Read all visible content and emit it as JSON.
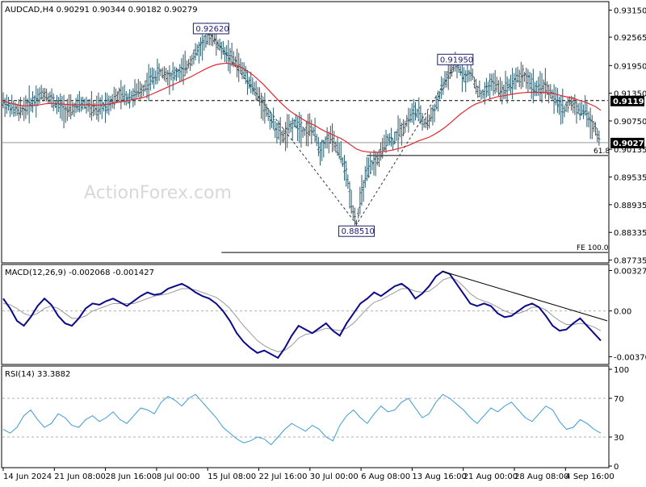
{
  "watermark": "ActionForex.com",
  "chart_data": [
    {
      "type": "candlestick",
      "header": "AUDCAD,H4  0.90291 0.90344 0.90182 0.90279",
      "symbol": "AUDCAD",
      "timeframe": "H4",
      "ohlc_last": {
        "open": 0.90291,
        "high": 0.90344,
        "low": 0.90182,
        "close": 0.90279
      },
      "ylim": [
        0.8771,
        0.933
      ],
      "y_ticks": [
        "0.93150",
        "0.92565",
        "0.91950",
        "0.91350",
        "0.90750",
        "0.90135",
        "0.89535",
        "0.88935",
        "0.88335",
        "0.87735"
      ],
      "x_ticks": [
        "14 Jun 2024",
        "21 Jun 08:00",
        "28 Jun 16:00",
        "8 Jul 00:00",
        "15 Jul 08:00",
        "22 Jul 16:00",
        "30 Jul 00:00",
        "6 Aug 08:00",
        "13 Aug 16:00",
        "21 Aug 00:00",
        "28 Aug 08:00",
        "4 Sep 16:00"
      ],
      "price_path": [
        0.9115,
        0.9108,
        0.91,
        0.9095,
        0.9102,
        0.911,
        0.912,
        0.913,
        0.9135,
        0.9125,
        0.9112,
        0.9105,
        0.91,
        0.9098,
        0.9105,
        0.9112,
        0.911,
        0.9102,
        0.9098,
        0.9105,
        0.9112,
        0.912,
        0.9128,
        0.913,
        0.9125,
        0.913,
        0.9138,
        0.9145,
        0.916,
        0.917,
        0.918,
        0.9178,
        0.9172,
        0.9175,
        0.918,
        0.9188,
        0.9205,
        0.922,
        0.9235,
        0.925,
        0.9262,
        0.9245,
        0.923,
        0.922,
        0.921,
        0.92,
        0.9185,
        0.917,
        0.915,
        0.913,
        0.911,
        0.909,
        0.907,
        0.905,
        0.904,
        0.9058,
        0.907,
        0.9065,
        0.9052,
        0.906,
        0.9045,
        0.901,
        0.903,
        0.904,
        0.902,
        0.9,
        0.896,
        0.89,
        0.8851,
        0.892,
        0.896,
        0.898,
        0.899,
        0.901,
        0.904,
        0.903,
        0.905,
        0.906,
        0.908,
        0.9095,
        0.909,
        0.907,
        0.9075,
        0.91,
        0.913,
        0.916,
        0.918,
        0.9195,
        0.9185,
        0.917,
        0.918,
        0.915,
        0.913,
        0.914,
        0.916,
        0.915,
        0.914,
        0.915,
        0.916,
        0.917,
        0.9175,
        0.9165,
        0.915,
        0.914,
        0.9155,
        0.914,
        0.9125,
        0.911,
        0.91,
        0.9115,
        0.911,
        0.9095,
        0.91,
        0.907,
        0.906,
        0.9028
      ],
      "sma_path": [
        0.9118,
        0.9115,
        0.9112,
        0.9109,
        0.9108,
        0.9108,
        0.9109,
        0.911,
        0.9112,
        0.9113,
        0.9113,
        0.9112,
        0.9111,
        0.911,
        0.911,
        0.911,
        0.911,
        0.911,
        0.9109,
        0.911,
        0.9111,
        0.9113,
        0.9115,
        0.9117,
        0.9119,
        0.9121,
        0.9123,
        0.9126,
        0.913,
        0.9135,
        0.914,
        0.9145,
        0.915,
        0.9155,
        0.916,
        0.9165,
        0.917,
        0.9176,
        0.9182,
        0.9188,
        0.9193,
        0.9197,
        0.9199,
        0.92,
        0.9198,
        0.9195,
        0.919,
        0.9183,
        0.9175,
        0.9165,
        0.9155,
        0.9143,
        0.9131,
        0.9119,
        0.9108,
        0.9098,
        0.909,
        0.9083,
        0.9076,
        0.907,
        0.9065,
        0.9058,
        0.9052,
        0.9047,
        0.9042,
        0.9037,
        0.903,
        0.9022,
        0.9014,
        0.901,
        0.9008,
        0.9007,
        0.9007,
        0.9008,
        0.901,
        0.9012,
        0.9015,
        0.9018,
        0.9022,
        0.9027,
        0.9032,
        0.9036,
        0.904,
        0.9046,
        0.9053,
        0.9061,
        0.907,
        0.908,
        0.909,
        0.9098,
        0.9106,
        0.9112,
        0.9116,
        0.912,
        0.9124,
        0.9127,
        0.9129,
        0.9131,
        0.9133,
        0.9135,
        0.9136,
        0.9137,
        0.9137,
        0.9137,
        0.9137,
        0.9136,
        0.9134,
        0.9131,
        0.9128,
        0.9126,
        0.9123,
        0.9119,
        0.9116,
        0.9111,
        0.9106,
        0.9098
      ],
      "ma_label": "",
      "current_price_label": "0.90279",
      "current_price": 0.90279,
      "resistance_line_label": "0.91190",
      "resistance_level": 0.9119,
      "annotations": [
        {
          "text": "0.92620",
          "price": 0.9262
        },
        {
          "text": "0.91950",
          "price": 0.9195
        },
        {
          "text": "0.88510",
          "price": 0.8851
        }
      ],
      "fib_lines": [
        {
          "text": "61.8",
          "price": 0.9
        },
        {
          "text": "FE 100.0",
          "price": 0.879
        }
      ],
      "colors": {
        "candle": "#2a5a6a",
        "sma": "#e0282e",
        "label_box": "#1a1a6e",
        "grid": "#000000"
      }
    },
    {
      "type": "line",
      "header": "MACD(12,26,9) -0.002068 -0.001427",
      "ylim": [
        -0.0042,
        0.0035
      ],
      "y_ticks": [
        "0.003272",
        "0.00",
        "-0.003703"
      ],
      "macd_path": [
        0.001,
        0.0002,
        -0.0008,
        -0.0012,
        -0.0005,
        0.0004,
        0.001,
        0.0005,
        -0.0004,
        -0.001,
        -0.0012,
        -0.0006,
        0.0002,
        0.0006,
        0.0005,
        0.0008,
        0.001,
        0.0007,
        0.0004,
        0.0008,
        0.0012,
        0.0015,
        0.0013,
        0.0014,
        0.0018,
        0.002,
        0.0022,
        0.0019,
        0.0015,
        0.0012,
        0.001,
        0.0006,
        0.0,
        -0.0008,
        -0.0018,
        -0.0025,
        -0.003,
        -0.0034,
        -0.0032,
        -0.0035,
        -0.0038,
        -0.003,
        -0.002,
        -0.0012,
        -0.0015,
        -0.0018,
        -0.0014,
        -0.001,
        -0.0016,
        -0.002,
        -0.001,
        -0.0002,
        0.0006,
        0.001,
        0.0015,
        0.0012,
        0.0016,
        0.002,
        0.0022,
        0.0018,
        0.001,
        0.0014,
        0.002,
        0.0028,
        0.0032,
        0.003,
        0.0022,
        0.0014,
        0.0006,
        0.0004,
        0.0006,
        0.0004,
        -0.0002,
        -0.0005,
        -0.0004,
        0.0,
        0.0004,
        0.0006,
        0.0003,
        -0.0004,
        -0.0012,
        -0.0016,
        -0.0015,
        -0.001,
        -0.0006,
        -0.0012,
        -0.0018,
        -0.0024
      ],
      "signal_path": [
        0.0006,
        0.0005,
        0.0002,
        -0.0002,
        -0.0004,
        -0.0002,
        0.0002,
        0.0004,
        0.0002,
        -0.0002,
        -0.0006,
        -0.0006,
        -0.0004,
        0.0,
        0.0002,
        0.0004,
        0.0006,
        0.0006,
        0.0006,
        0.0006,
        0.0008,
        0.001,
        0.0012,
        0.0013,
        0.0014,
        0.0016,
        0.0018,
        0.0018,
        0.0017,
        0.0015,
        0.0013,
        0.0011,
        0.0007,
        0.0002,
        -0.0005,
        -0.0012,
        -0.0018,
        -0.0024,
        -0.0028,
        -0.0031,
        -0.0033,
        -0.0032,
        -0.0028,
        -0.0022,
        -0.0019,
        -0.0018,
        -0.0016,
        -0.0014,
        -0.0015,
        -0.0016,
        -0.0014,
        -0.001,
        -0.0004,
        0.0002,
        0.0007,
        0.0009,
        0.0012,
        0.0015,
        0.0018,
        0.0018,
        0.0016,
        0.0015,
        0.0016,
        0.002,
        0.0025,
        0.0027,
        0.0025,
        0.002,
        0.0014,
        0.001,
        0.0008,
        0.0006,
        0.0003,
        0.0,
        -0.0002,
        -0.0002,
        0.0,
        0.0003,
        0.0003,
        0.0001,
        -0.0004,
        -0.0008,
        -0.0011,
        -0.0011,
        -0.001,
        -0.0011,
        -0.0013,
        -0.0016
      ],
      "trendline": {
        "from": 0.0032,
        "to": -0.0008
      },
      "colors": {
        "macd": "#0a0a8a",
        "signal": "#9a9a9a",
        "trendline": "#000000"
      }
    },
    {
      "type": "line",
      "header": "RSI(14) 33.3882",
      "ylim": [
        0,
        100
      ],
      "y_ticks": [
        "100",
        "70",
        "30",
        "0"
      ],
      "levels": [
        70,
        30
      ],
      "rsi_path": [
        38,
        34,
        40,
        52,
        58,
        48,
        40,
        44,
        54,
        50,
        42,
        40,
        48,
        52,
        46,
        50,
        56,
        48,
        44,
        52,
        60,
        58,
        54,
        66,
        72,
        68,
        62,
        70,
        74,
        66,
        58,
        50,
        40,
        34,
        28,
        24,
        26,
        30,
        28,
        22,
        30,
        38,
        44,
        40,
        36,
        42,
        38,
        30,
        26,
        42,
        52,
        58,
        50,
        44,
        54,
        62,
        56,
        58,
        66,
        70,
        60,
        50,
        54,
        66,
        74,
        70,
        64,
        58,
        50,
        44,
        52,
        60,
        56,
        62,
        66,
        58,
        50,
        46,
        54,
        62,
        58,
        46,
        38,
        40,
        48,
        44,
        38,
        34
      ],
      "colors": {
        "rsi": "#3c9ad6",
        "level": "#b0b0b0"
      }
    }
  ]
}
